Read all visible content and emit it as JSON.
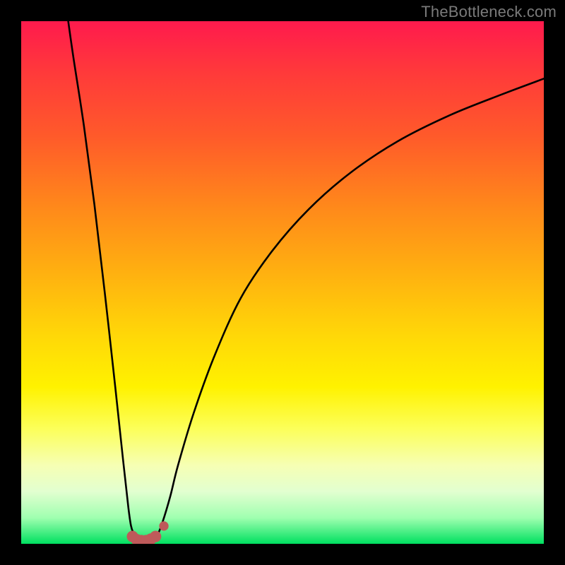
{
  "watermark": {
    "text": "TheBottleneck.com"
  },
  "chart_data": {
    "type": "line",
    "title": "",
    "xlabel": "",
    "ylabel": "",
    "xlim": [
      0,
      100
    ],
    "ylim": [
      0,
      100
    ],
    "series": [
      {
        "name": "left-curve",
        "x": [
          9,
          10,
          12,
          14,
          16,
          18,
          19.5,
          20.5,
          21,
          21.5,
          22,
          22.5
        ],
        "y": [
          100,
          93,
          80,
          65,
          48,
          30,
          16,
          7,
          3.5,
          2,
          1.2,
          1
        ]
      },
      {
        "name": "right-curve",
        "x": [
          25.5,
          26,
          27,
          28.5,
          30,
          33,
          37,
          42,
          48,
          55,
          63,
          72,
          82,
          92,
          100
        ],
        "y": [
          1,
          1.5,
          4,
          9,
          15,
          25,
          36,
          47,
          56,
          64,
          71,
          77,
          82,
          86,
          89
        ]
      }
    ],
    "markers": [
      {
        "name": "trough-marker-1",
        "x": 21.3,
        "y": 1.4,
        "r": 1.1
      },
      {
        "name": "trough-marker-2",
        "x": 22.1,
        "y": 0.8,
        "r": 1.1
      },
      {
        "name": "trough-marker-3",
        "x": 23.0,
        "y": 0.6,
        "r": 1.1
      },
      {
        "name": "trough-marker-4",
        "x": 23.9,
        "y": 0.6,
        "r": 1.1
      },
      {
        "name": "trough-marker-5",
        "x": 24.8,
        "y": 0.9,
        "r": 1.1
      },
      {
        "name": "trough-marker-6",
        "x": 25.7,
        "y": 1.4,
        "r": 1.1
      },
      {
        "name": "trough-marker-gap",
        "x": 27.3,
        "y": 3.4,
        "r": 0.9
      }
    ],
    "colors": {
      "curve": "#000000",
      "marker": "#be5a5a"
    }
  }
}
